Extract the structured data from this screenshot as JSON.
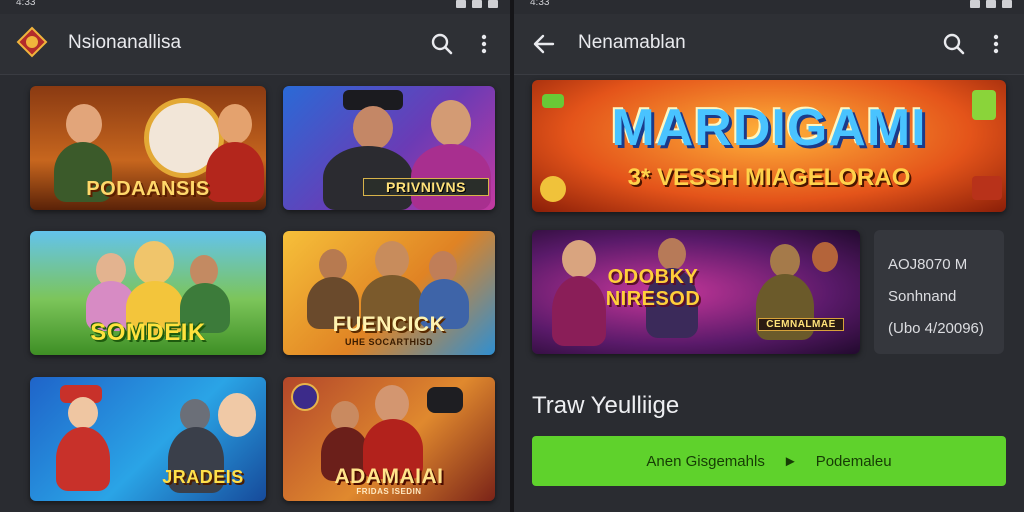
{
  "status": {
    "time": "4:33"
  },
  "left": {
    "title": "Nsionanallisa",
    "cards": [
      {
        "caption": "PODAANSIS"
      },
      {
        "caption": "PRIVNIVNS"
      },
      {
        "caption": "SOMDEIK"
      },
      {
        "caption": "FUENCICK",
        "sub": "UHE SOCARTHISD"
      },
      {
        "caption": "JRADEIS"
      },
      {
        "caption": "ADAMAIAI",
        "sub": "FRIDAS ISEDIN"
      }
    ]
  },
  "right": {
    "title": "Nenamablan",
    "banner": {
      "title": "MARDIGAMI",
      "subtitle": "3* VESSH MIAGELORAO"
    },
    "promo": {
      "caption": "ODOBKY NIRESOD",
      "caption2": "CEMNALMAE"
    },
    "info": {
      "line1": "AOJ8070 M",
      "line2": "Sonhnand",
      "line3": "(Ubo 4/20096)"
    },
    "section_title": "Traw Yeulliige",
    "cta": {
      "left": "Anen Gisgemahls",
      "arrow": "►",
      "right": "Podemaleu"
    }
  },
  "colors": {
    "accent": "#5fd22c",
    "background": "#2a2c31"
  }
}
